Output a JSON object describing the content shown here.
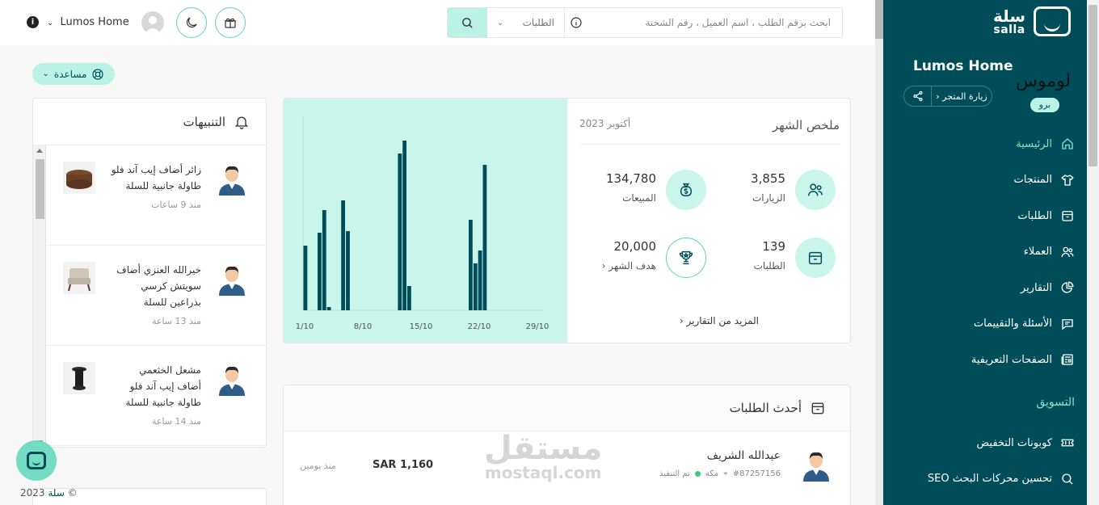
{
  "topbar": {
    "user_name": "Lumos Home",
    "search_placeholder": "ابحث برقم الطلب ، اسم العميل ، رقم الشحنة",
    "search_scope": "الطلبات"
  },
  "help": {
    "label": "مساعدة"
  },
  "sidebar": {
    "brand_ar": "سلة",
    "brand_en": "salla",
    "store_name": "Lumos Home",
    "store_script": "لوموس",
    "visit_store": "زيارة المتجر",
    "plan_badge": "برو",
    "items": [
      {
        "label": "الرئيسية",
        "icon": "home-icon"
      },
      {
        "label": "المنتجات",
        "icon": "shirt-icon"
      },
      {
        "label": "الطلبات",
        "icon": "box-icon"
      },
      {
        "label": "العملاء",
        "icon": "users-icon"
      },
      {
        "label": "التقارير",
        "icon": "pie-chart-icon"
      },
      {
        "label": "الأسئلة والتقييمات",
        "icon": "message-icon"
      },
      {
        "label": "الصفحات التعريفية",
        "icon": "newspaper-icon"
      }
    ],
    "section_marketing": "التسويق",
    "marketing_items": [
      {
        "label": "كوبونات التخفيض",
        "icon": "ticket-icon"
      },
      {
        "label": "تحسين محركات البحث SEO",
        "icon": "search-icon"
      }
    ],
    "colors": {
      "bg": "#004d5a",
      "active": "#7ee8d0"
    }
  },
  "notifications": {
    "title": "التنبيهات",
    "items": [
      {
        "line1": "زائر أضاف إيب آند فلو",
        "line2": "طاولة جانبية للسلة",
        "line3": "",
        "time": "منذ 9 ساعات",
        "thumb": "round-table"
      },
      {
        "line1": "خيرالله العنزي أضاف",
        "line2": "سويتش كرسي",
        "line3": "بذراعين للسلة",
        "time": "منذ 13 ساعة",
        "thumb": "armchair"
      },
      {
        "line1": "مشعل الخثعمي",
        "line2": "أضاف إيب آند فلو",
        "line3": "طاولة جانبية للسلة",
        "time": "منذ 14 ساعة",
        "thumb": "side-table"
      }
    ]
  },
  "summary": {
    "title": "ملخص الشهر",
    "date": "أكتوبر 2023",
    "stats": {
      "visits": {
        "value": "3,855",
        "label": "الزيارات"
      },
      "sales": {
        "value": "134,780",
        "label": "المبيعات"
      },
      "orders": {
        "value": "139",
        "label": "الطلبات"
      },
      "goal": {
        "value": "20,000",
        "label": "هدف الشهر"
      }
    },
    "more_link": "المزيد من التقارير"
  },
  "chart_data": {
    "type": "bar",
    "x_tick_labels": [
      "1/10",
      "8/10",
      "15/10",
      "22/10",
      "29/10"
    ],
    "values": [
      4,
      0,
      0,
      4.8,
      6.2,
      0.2,
      0,
      0,
      6.8,
      4.9,
      0,
      0,
      0,
      0,
      0,
      0,
      0,
      0,
      0,
      0,
      9.7,
      10.5,
      1.5,
      0,
      0,
      0,
      0,
      0,
      0,
      0,
      0,
      0,
      0,
      0,
      0,
      5.6,
      2.9,
      3.7,
      9.0,
      0,
      0,
      0,
      0,
      0,
      0,
      0,
      0,
      0,
      0,
      0,
      0
    ],
    "grid": false,
    "bar_color": "#004d5a",
    "bg_color": "#caf5ea"
  },
  "orders": {
    "title": "أحدث الطلبات",
    "rows": [
      {
        "customer": "عبدالله الشريف",
        "order_no": "#87257156",
        "city": "مكة",
        "status": "تم التنفيذ",
        "amount": "SAR 1,160",
        "ago": "منذ يومين"
      }
    ]
  },
  "watermark": {
    "ar": "مستقل",
    "en": "mostaql.com"
  },
  "footer": {
    "year": "2023 ©",
    "brand": "سلة"
  }
}
